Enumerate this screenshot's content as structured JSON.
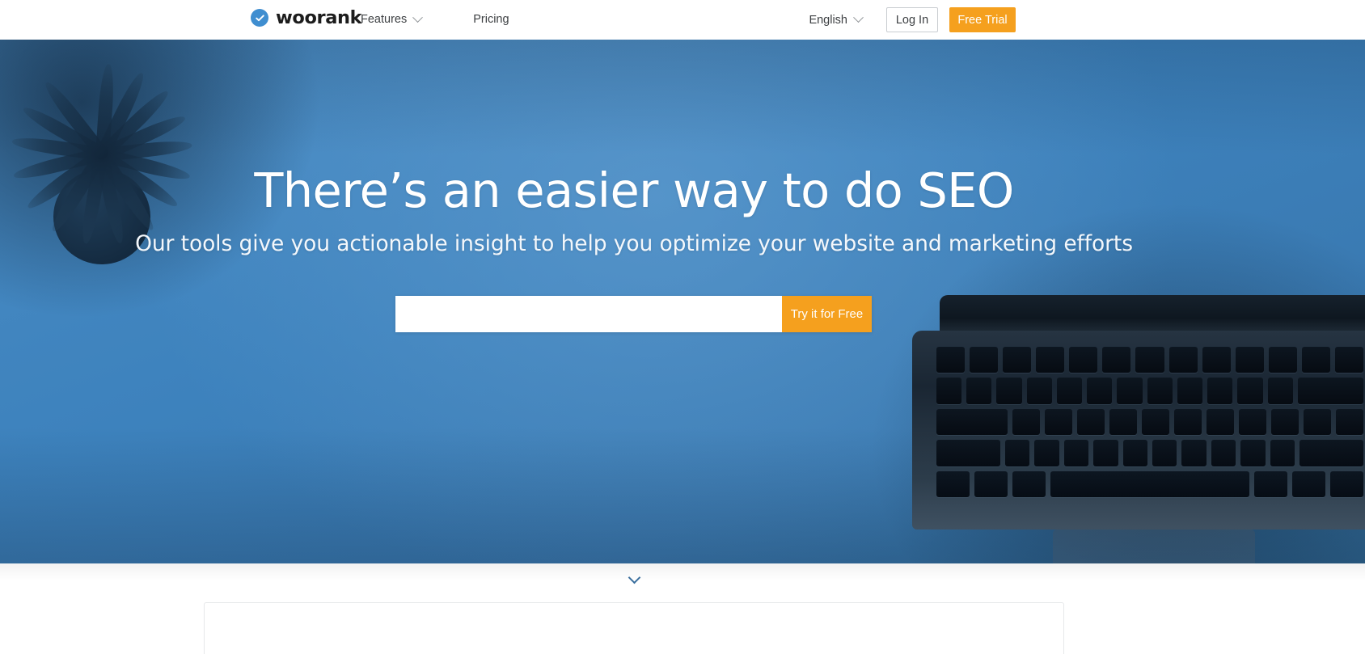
{
  "header": {
    "brand": {
      "name": "woorank",
      "badge_icon": "check-badge-icon",
      "badge_color": "#3f8ed0"
    },
    "nav": [
      {
        "label": "Features",
        "has_dropdown": true
      },
      {
        "label": "Pricing",
        "has_dropdown": false
      }
    ],
    "language": {
      "label": "English",
      "has_dropdown": true
    },
    "login_label": "Log In",
    "trial_label": "Free Trial",
    "trial_color": "#f5a01e"
  },
  "hero": {
    "title": "There’s an easier way to do SEO",
    "subtitle": "Our tools give you actionable insight to help you optimize your website and marketing efforts",
    "search": {
      "value": "",
      "placeholder": ""
    },
    "cta_label": "Try it for Free",
    "cta_color": "#f5a01e",
    "background_color": "#3d82bd"
  },
  "below_hero": {
    "scroll_icon": "chevron-down-icon",
    "scroll_icon_color": "#3a6f9e"
  }
}
